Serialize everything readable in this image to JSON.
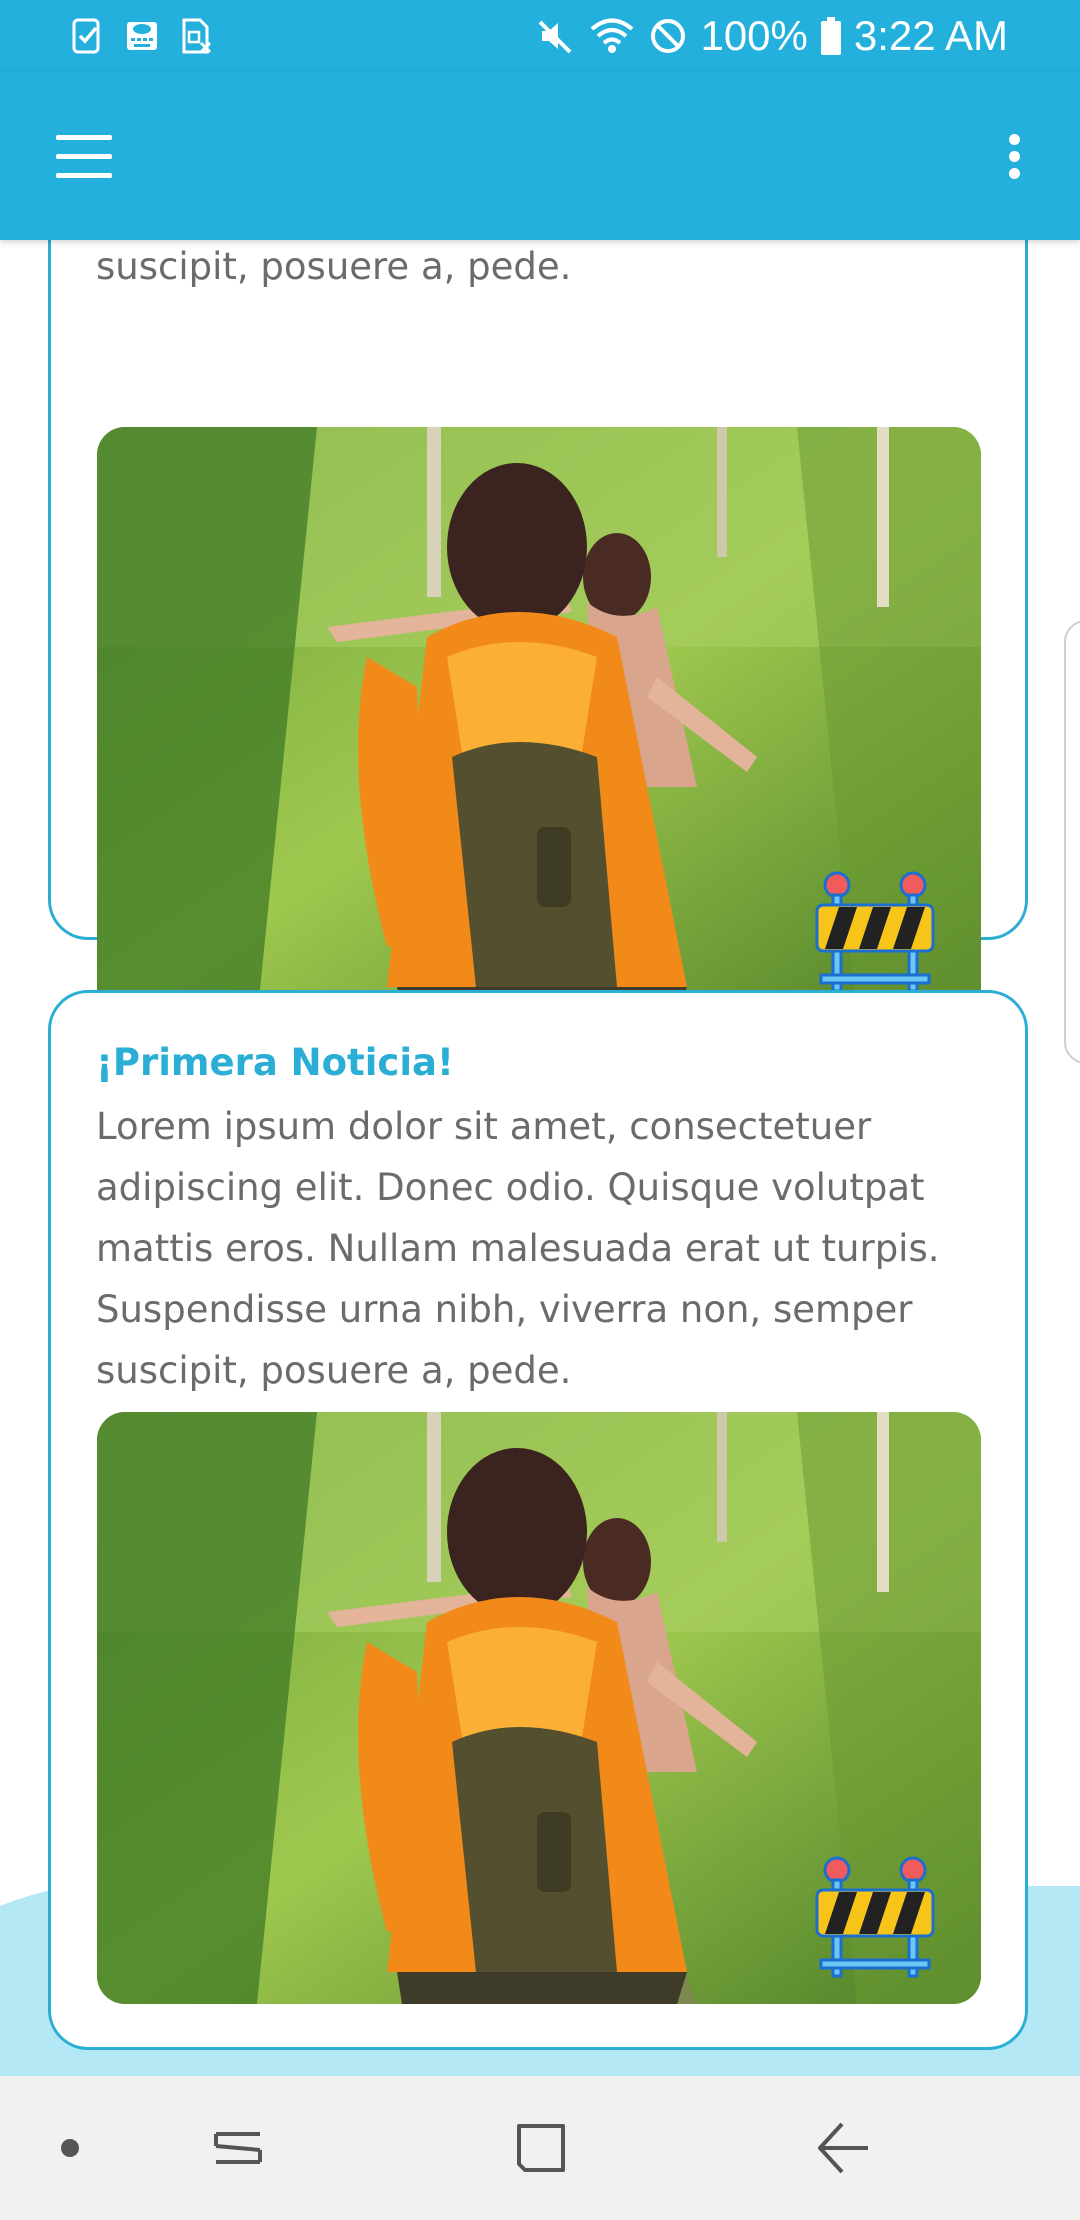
{
  "status_bar": {
    "battery": "100%",
    "time": "3:22 AM",
    "icons": [
      "task-check-icon",
      "cloud-keyboard-icon",
      "sim-card-icon",
      "mute-icon",
      "wifi-icon",
      "no-disturb-icon",
      "battery-icon"
    ]
  },
  "app_bar": {
    "background": "#24b0dc",
    "icons": [
      "hamburger-menu-icon",
      "more-vertical-icon"
    ]
  },
  "cards": [
    {
      "body_visible": "suscipit, posuere a, pede.",
      "image": "hikers-photo",
      "badge_icon": "construction-barrier-icon"
    },
    {
      "title": "¡Primera Noticia!",
      "body": "Lorem ipsum dolor sit amet, consectetuer adipiscing elit. Donec odio. Quisque volutpat mattis eros. Nullam malesuada erat ut turpis. Suspendisse urna nibh, viverra non, semper suscipit, posuere a, pede.",
      "image": "hikers-photo",
      "badge_icon": "construction-barrier-icon"
    }
  ],
  "nav_bar": {
    "icons": [
      "dot-icon",
      "recents-icon",
      "home-icon",
      "back-icon"
    ]
  },
  "colors": {
    "primary": "#24b0dc",
    "card_border": "#2aaed6",
    "title": "#2aaed6",
    "body_text": "#6b6b6b",
    "wave": "#b3e8f4"
  }
}
